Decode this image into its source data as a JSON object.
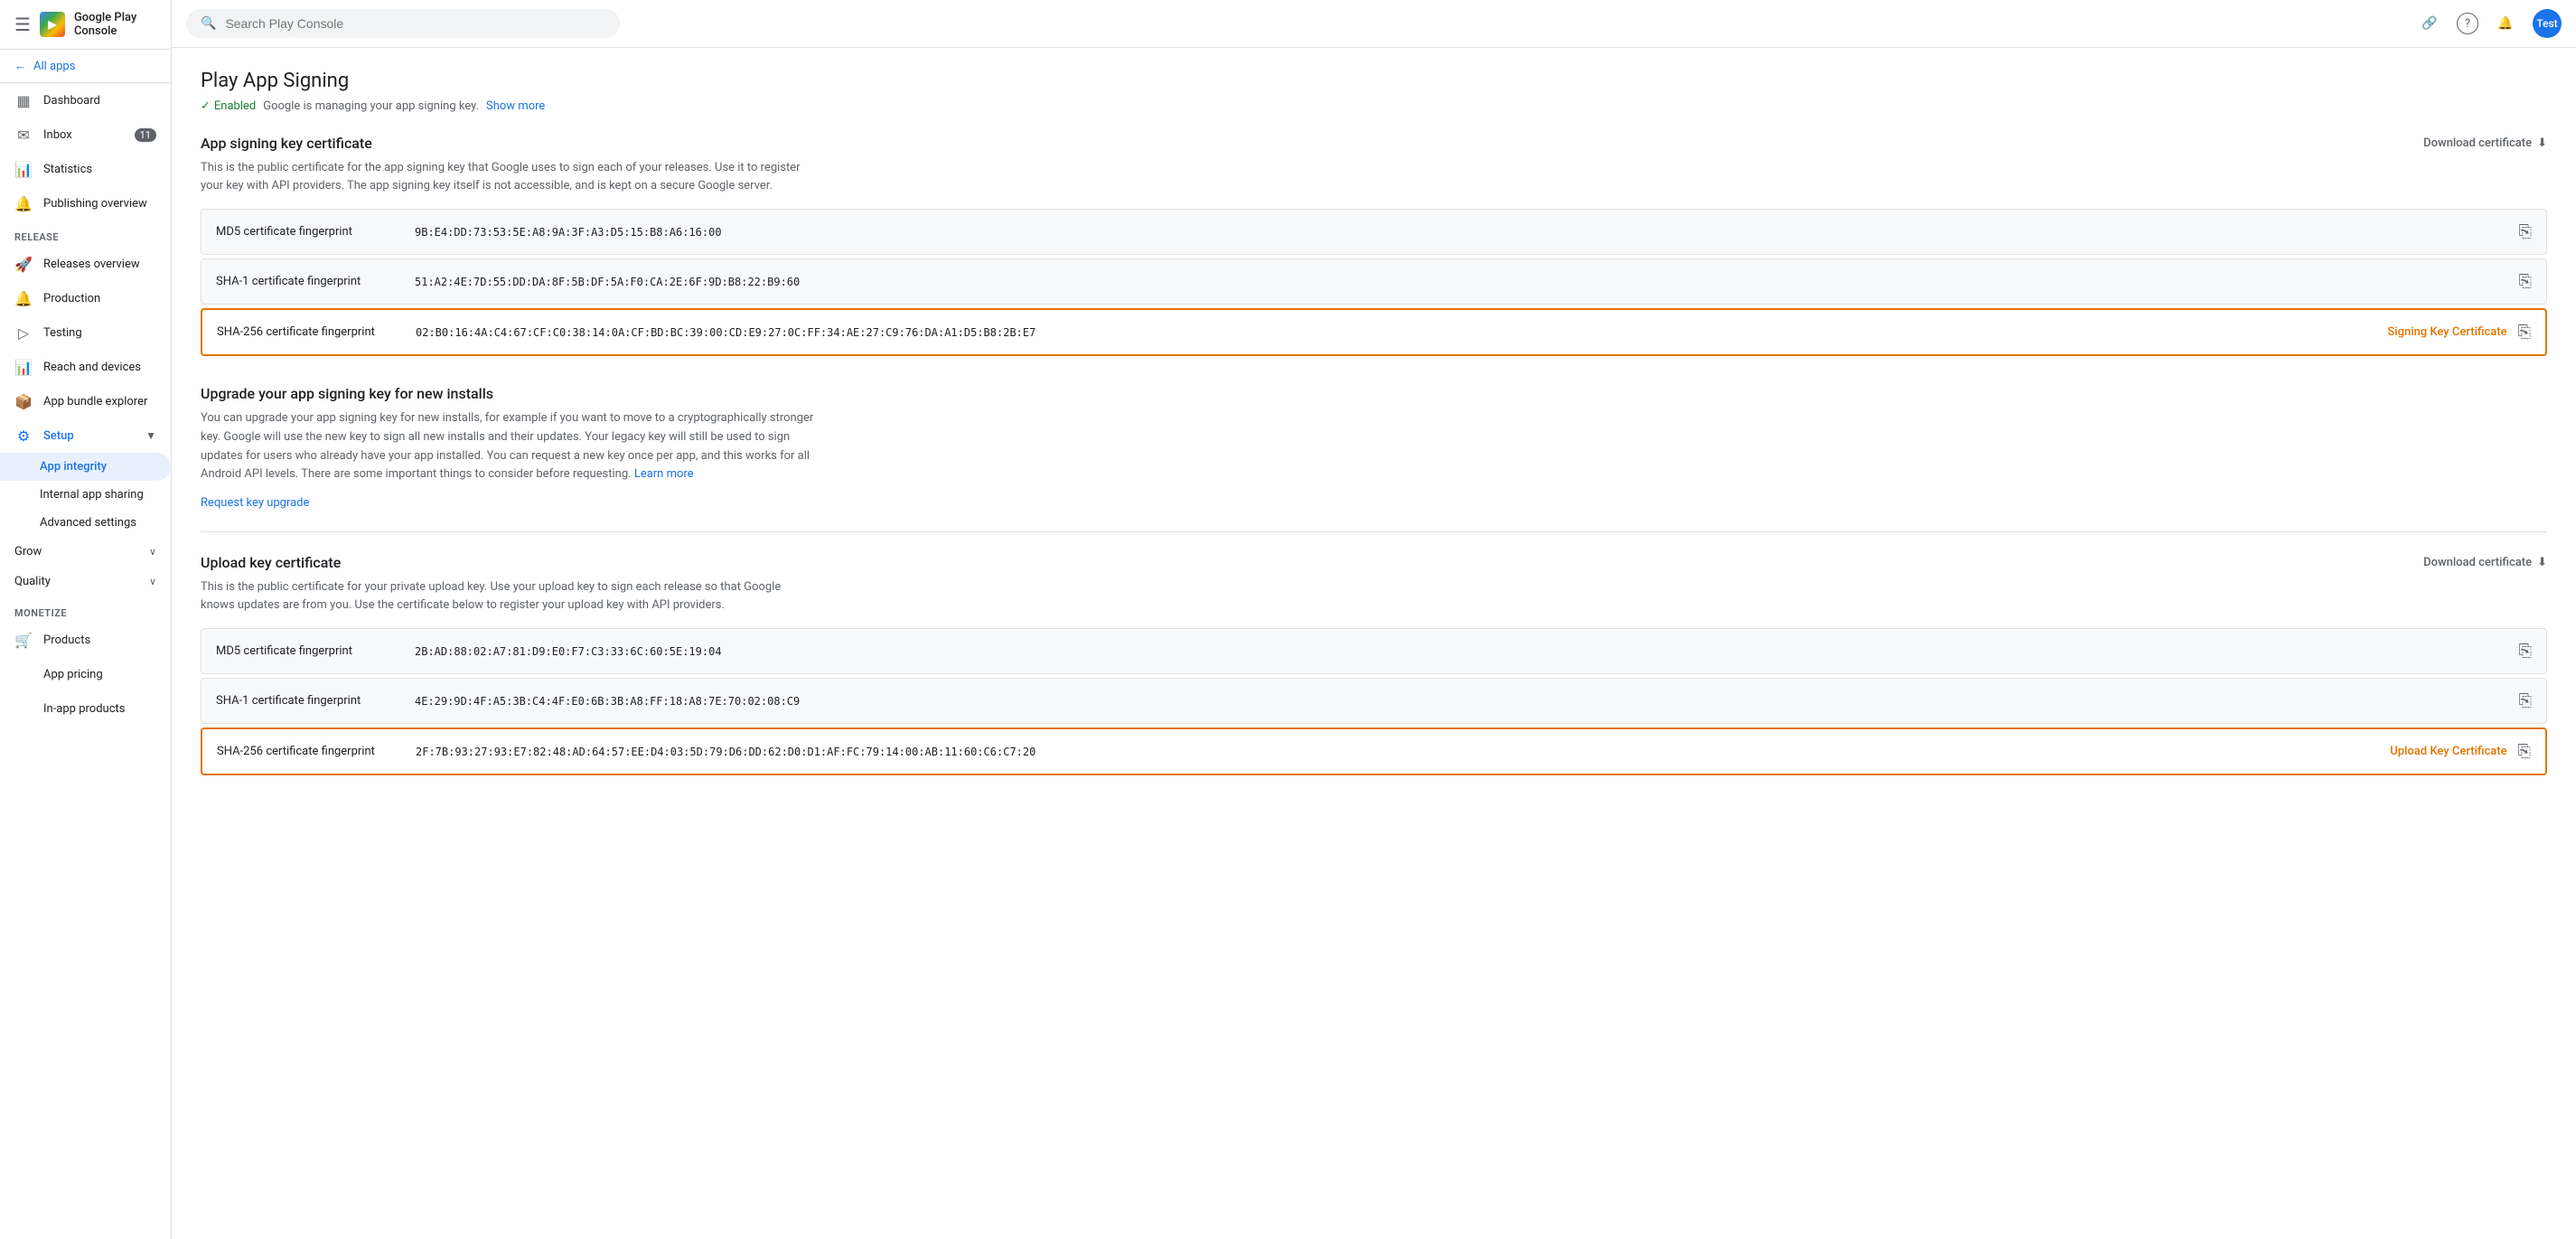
{
  "sidebar": {
    "app_title": "Google Play Console",
    "all_apps_label": "All apps",
    "nav_items": [
      {
        "id": "dashboard",
        "label": "Dashboard",
        "icon": "▦"
      },
      {
        "id": "inbox",
        "label": "Inbox",
        "icon": "✉",
        "badge": "11"
      },
      {
        "id": "statistics",
        "label": "Statistics",
        "icon": "📊"
      },
      {
        "id": "publishing",
        "label": "Publishing overview",
        "icon": "🔔"
      }
    ],
    "release_section": "Release",
    "release_items": [
      {
        "id": "releases-overview",
        "label": "Releases overview",
        "icon": "🚀"
      },
      {
        "id": "production",
        "label": "Production",
        "icon": "🔔"
      },
      {
        "id": "testing",
        "label": "Testing",
        "icon": "🔔"
      },
      {
        "id": "reach-devices",
        "label": "Reach and devices",
        "icon": "📊"
      },
      {
        "id": "app-bundle",
        "label": "App bundle explorer",
        "icon": "📦"
      }
    ],
    "setup_label": "Setup",
    "setup_icon": "⚙",
    "setup_sub_items": [
      {
        "id": "app-integrity",
        "label": "App integrity",
        "active": true
      },
      {
        "id": "internal-sharing",
        "label": "Internal app sharing"
      },
      {
        "id": "advanced-settings",
        "label": "Advanced settings"
      }
    ],
    "grow_label": "Grow",
    "quality_label": "Quality",
    "monetize_label": "Monetize",
    "monetize_items": [
      {
        "id": "products",
        "label": "Products"
      },
      {
        "id": "app-pricing",
        "label": "App pricing"
      },
      {
        "id": "in-app-products",
        "label": "In-app products"
      }
    ]
  },
  "topbar": {
    "search_placeholder": "Search Play Console",
    "link_icon": "🔗",
    "help_icon": "?",
    "notifications_icon": "🔔",
    "user_label": "Test"
  },
  "page": {
    "title": "Play App Signing",
    "enabled_label": "Enabled",
    "enabled_desc": "Google is managing your app signing key.",
    "show_more": "Show more",
    "app_signing_section": {
      "title": "App signing key certificate",
      "download_label": "Download certificate",
      "description": "This is the public certificate for the app signing key that Google uses to sign each of your releases. Use it to register your key with API providers. The app signing key itself is not accessible, and is kept on a secure Google server.",
      "rows": [
        {
          "label": "MD5 certificate fingerprint",
          "value": "9B:E4:DD:73:53:5E:A8:9A:3F:A3:D5:15:B8:A6:16:00",
          "highlighted": false,
          "badge": ""
        },
        {
          "label": "SHA-1 certificate fingerprint",
          "value": "51:A2:4E:7D:55:DD:DA:8F:5B:DF:5A:F0:CA:2E:6F:9D:B8:22:B9:60",
          "highlighted": false,
          "badge": ""
        },
        {
          "label": "SHA-256 certificate fingerprint",
          "value": "02:B0:16:4A:C4:67:CF:C0:38:14:0A:CF:BD:BC:39:00:CD:E9:27:0C:FF:34:AE:27:C9:76:DA:A1:D5:B8:2B:E7",
          "highlighted": true,
          "badge": "Signing Key Certificate"
        }
      ]
    },
    "upgrade_section": {
      "title": "Upgrade your app signing key for new installs",
      "description": "You can upgrade your app signing key for new installs, for example if you want to move to a cryptographically stronger key. Google will use the new key to sign all new installs and their updates. Your legacy key will still be used to sign updates for users who already have your app installed. You can request a new key once per app, and this works for all Android API levels. There are some important things to consider before requesting.",
      "learn_more": "Learn more",
      "request_upgrade": "Request key upgrade"
    },
    "upload_section": {
      "title": "Upload key certificate",
      "download_label": "Download certificate",
      "description": "This is the public certificate for your private upload key. Use your upload key to sign each release so that Google knows updates are from you. Use the certificate below to register your upload key with API providers.",
      "rows": [
        {
          "label": "MD5 certificate fingerprint",
          "value": "2B:AD:88:02:A7:81:D9:E0:F7:C3:33:6C:60:5E:19:04",
          "highlighted": false,
          "badge": ""
        },
        {
          "label": "SHA-1 certificate fingerprint",
          "value": "4E:29:9D:4F:A5:3B:C4:4F:E0:6B:3B:A8:FF:18:A8:7E:70:02:08:C9",
          "highlighted": false,
          "badge": ""
        },
        {
          "label": "SHA-256 certificate fingerprint",
          "value": "2F:7B:93:27:93:E7:82:48:AD:64:57:EE:D4:03:5D:79:D6:DD:62:D0:D1:AF:FC:79:14:00:AB:11:60:C6:C7:20",
          "highlighted": true,
          "badge": "Upload Key Certificate"
        }
      ]
    }
  }
}
